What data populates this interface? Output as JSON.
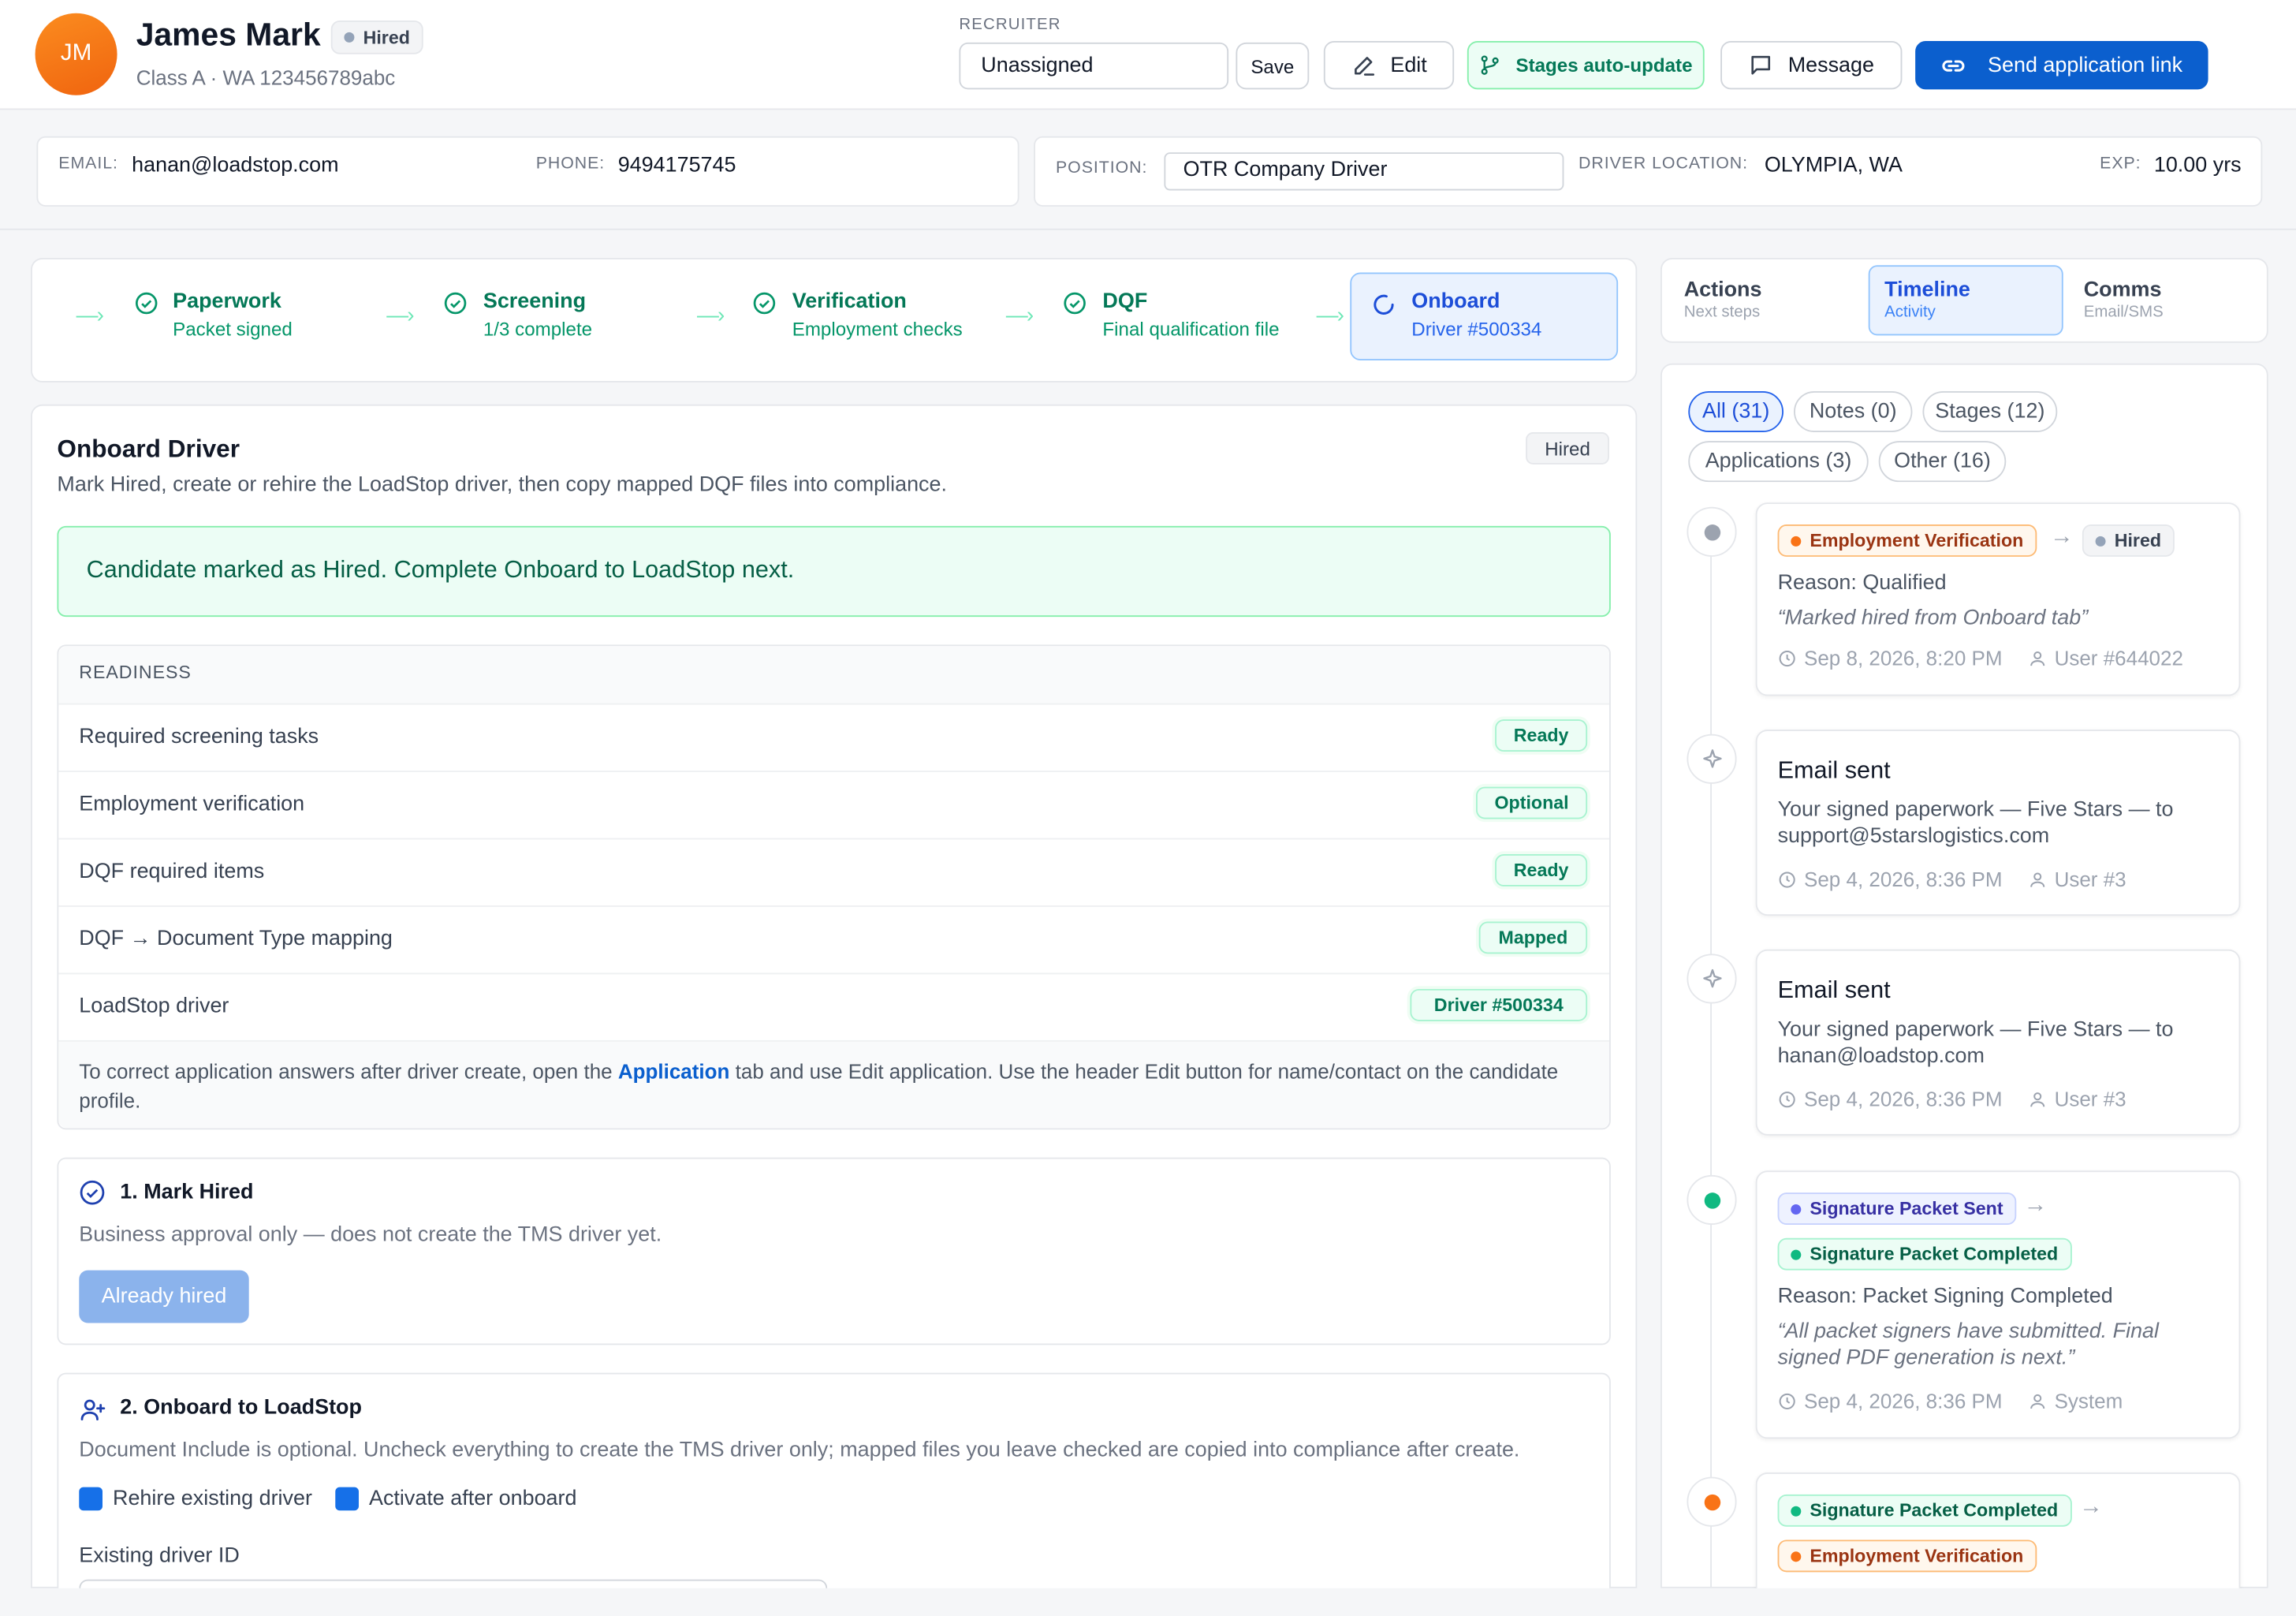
{
  "candidate": {
    "initials": "JM",
    "name": "James Mark",
    "status": "Hired",
    "subline": "Class A · WA 123456789abc"
  },
  "recruiter": {
    "label": "RECRUITER",
    "value": "Unassigned"
  },
  "actions": {
    "save": "Save",
    "edit": "Edit",
    "stages_auto": "Stages auto-update",
    "message": "Message",
    "send_link": "Send application link"
  },
  "contact": {
    "email_label": "EMAIL:",
    "email": "hanan@loadstop.com",
    "phone_label": "PHONE:",
    "phone": "9494175745"
  },
  "job": {
    "position_label": "POSITION:",
    "position": "OTR Company Driver",
    "location_label": "DRIVER LOCATION:",
    "location": "OLYMPIA, WA",
    "exp_label": "EXP:",
    "exp": "10.00 yrs"
  },
  "stages": [
    {
      "title": "Paperwork",
      "sub": "Packet signed"
    },
    {
      "title": "Screening",
      "sub": "1/3 complete"
    },
    {
      "title": "Verification",
      "sub": "Employment checks"
    },
    {
      "title": "DQF",
      "sub": "Final qualification file"
    },
    {
      "title": "Onboard",
      "sub": "Driver #500334"
    }
  ],
  "onboard": {
    "title": "Onboard Driver",
    "badge": "Hired",
    "desc": "Mark Hired, create or rehire the LoadStop driver, then copy mapped DQF files into compliance.",
    "alert": "Candidate marked as Hired. Complete Onboard to LoadStop next.",
    "readiness_label": "READINESS",
    "readiness": [
      {
        "label": "Required screening tasks",
        "status": "Ready"
      },
      {
        "label": "Employment verification",
        "status": "Optional"
      },
      {
        "label": "DQF required items",
        "status": "Ready"
      },
      {
        "label": "DQF → Document Type mapping",
        "status": "Mapped"
      },
      {
        "label": "LoadStop driver",
        "status": "Driver #500334"
      }
    ],
    "note_pre": "To correct application answers after driver create, open the ",
    "note_link": "Application",
    "note_post": " tab and use Edit application. Use the header Edit button for name/contact on the candidate profile.",
    "step1_title": "1. Mark Hired",
    "step1_desc": "Business approval only — does not create the TMS driver yet.",
    "step1_button": "Already hired",
    "step2_title": "2. Onboard to LoadStop",
    "step2_desc": "Document Include is optional. Uncheck everything to create the TMS driver only; mapped files you leave checked are copied into compliance after create.",
    "opt_rehire": "Rehire existing driver",
    "opt_activate": "Activate after onboard",
    "existing_label": "Existing driver ID"
  },
  "side_tabs": [
    {
      "title": "Actions",
      "sub": "Next steps"
    },
    {
      "title": "Timeline",
      "sub": "Activity"
    },
    {
      "title": "Comms",
      "sub": "Email/SMS"
    }
  ],
  "filters": [
    "All (31)",
    "Notes (0)",
    "Stages (12)",
    "Applications (3)",
    "Other (16)"
  ],
  "timeline": [
    {
      "from": "Employment Verification",
      "to": "Hired",
      "reason": "Reason: Qualified",
      "quote": "“Marked hired from Onboard tab”",
      "date": "Sep 8, 2026, 8:20 PM",
      "user": "User #644022"
    },
    {
      "title": "Email sent",
      "body": "Your signed paperwork — Five Stars — to support@5starslogistics.com",
      "date": "Sep 4, 2026, 8:36 PM",
      "user": "User #3"
    },
    {
      "title": "Email sent",
      "body": "Your signed paperwork — Five Stars — to hanan@loadstop.com",
      "date": "Sep 4, 2026, 8:36 PM",
      "user": "User #3"
    },
    {
      "from": "Signature Packet Sent",
      "to": "Signature Packet Completed",
      "reason": "Reason: Packet Signing Completed",
      "quote": "“All packet signers have submitted. Final signed PDF generation is next.”",
      "date": "Sep 4, 2026, 8:36 PM",
      "user": "System"
    },
    {
      "from": "Signature Packet Completed",
      "to": "Employment Verification"
    }
  ],
  "colors": {
    "brand_blue": "#0b5fce",
    "success": "#047857",
    "avatar": "#f57a1a"
  }
}
